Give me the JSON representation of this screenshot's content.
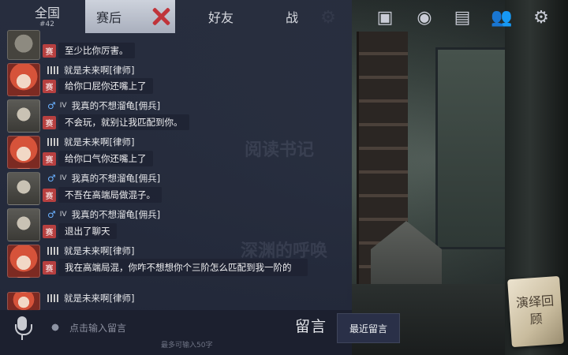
{
  "tabs": [
    {
      "label": "全国",
      "sub": "#42"
    },
    {
      "label": "赛后"
    },
    {
      "label": "好友"
    },
    {
      "label": "战"
    }
  ],
  "badge": "赛",
  "messages": [
    {
      "type": "text",
      "text": "至少比你厉害。"
    },
    {
      "type": "name",
      "name": "就是未来啊[律师]"
    },
    {
      "type": "text",
      "text": "给你口屁你还嘴上了"
    },
    {
      "type": "name",
      "name": "我真的不想溜龟[佣兵]"
    },
    {
      "type": "text",
      "text": "不会玩，就别让我匹配到你。"
    },
    {
      "type": "name",
      "name": "就是未来啊[律师]"
    },
    {
      "type": "text",
      "text": "给你口气你还嘴上了"
    },
    {
      "type": "name",
      "name": "我真的不想溜龟[佣兵]"
    },
    {
      "type": "text",
      "text": "不吾在高端局做混子。"
    },
    {
      "type": "name",
      "name": "我真的不想溜龟[佣兵]"
    },
    {
      "type": "text",
      "text": "退出了聊天"
    },
    {
      "type": "name",
      "name": "就是未来啊[律师]"
    },
    {
      "type": "text",
      "text": "我在高端局混，你咋不想想你个三阶怎么匹配到我一阶的"
    },
    {
      "type": "name",
      "name": "就是未来啊[律师]"
    }
  ],
  "input": {
    "placeholder": "点击输入留言",
    "limit": "最多可输入50字"
  },
  "leave_message": "留言",
  "recent_messages": "最近留言",
  "replay": "演绎回顾",
  "watermarks": [
    "阅读书记",
    "深渊的呼唤"
  ],
  "icons": [
    "gear-icon",
    "map-icon",
    "badge-icon",
    "portrait-icon",
    "diary-icon",
    "friends-icon",
    "settings-icon"
  ],
  "colors": {
    "badge": "#b74040",
    "active_tab": "#cdd2dc",
    "close_mark": "#c0343a"
  }
}
